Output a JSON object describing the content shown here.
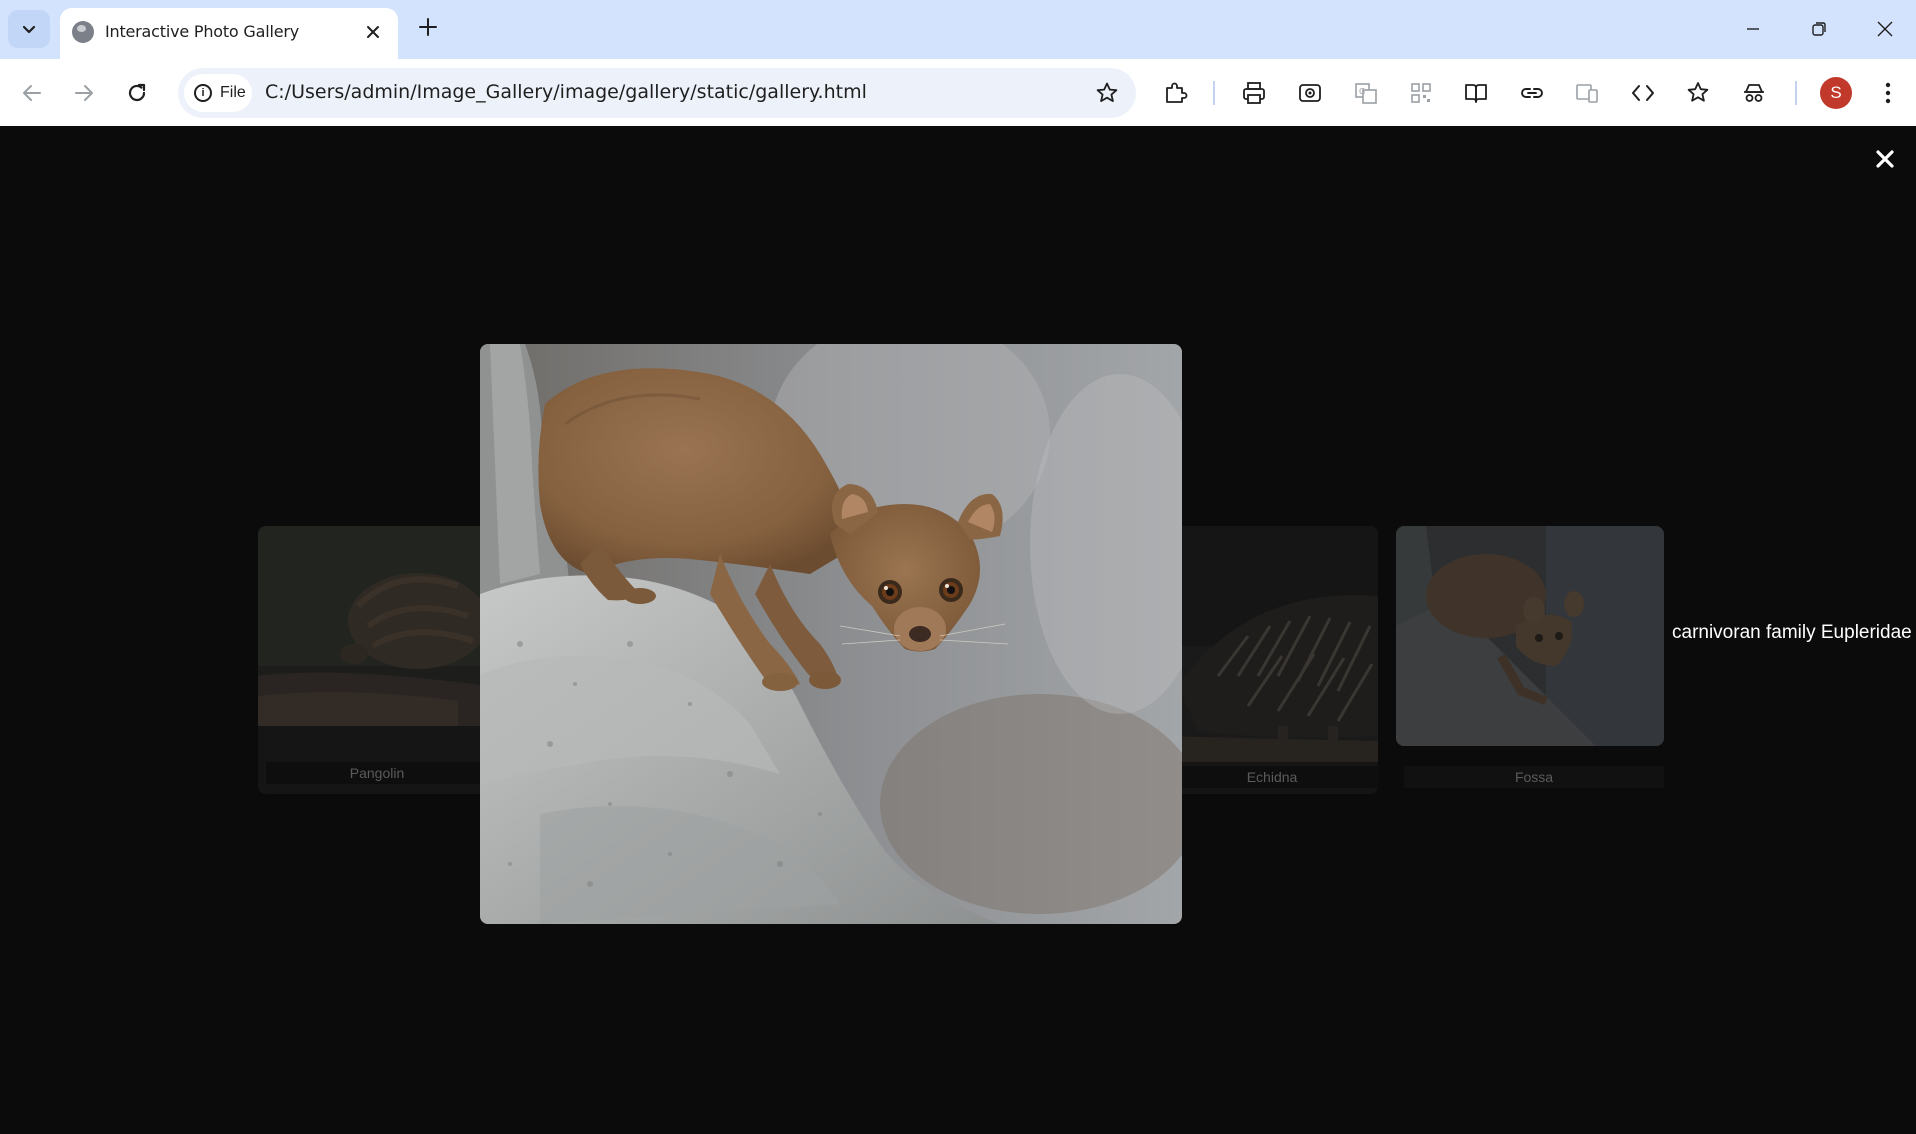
{
  "browser": {
    "tab_title": "Interactive Photo Gallery",
    "chip_label": "File",
    "url": "C:/Users/admin/Image_Gallery/image/gallery/static/gallery.html",
    "profile_initial": "S"
  },
  "gallery": {
    "cards": [
      {
        "caption": "Pangolin"
      },
      {
        "caption": "Echidna"
      },
      {
        "caption": "Fossa"
      }
    ],
    "side_description": "carnivoran family Eupleridae"
  }
}
